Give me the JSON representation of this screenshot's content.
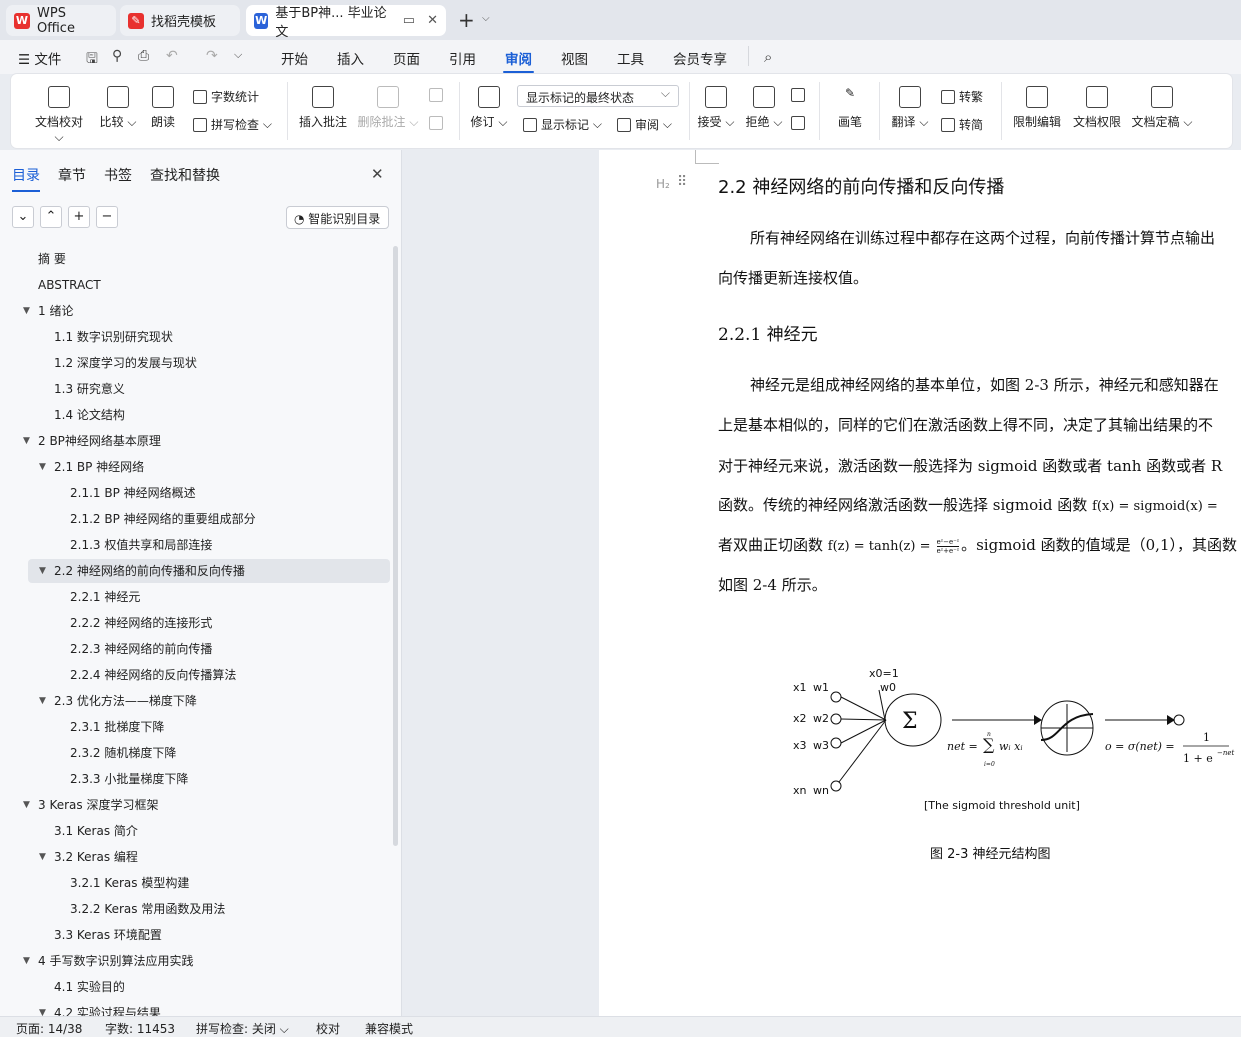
{
  "tabs": [
    {
      "label": "WPS Office",
      "icon": "wps-logo-icon"
    },
    {
      "label": "找稻壳模板",
      "icon": "docer-logo-icon"
    },
    {
      "label": "基于BP神... 毕业论文",
      "icon": "word-doc-icon"
    }
  ],
  "menu": {
    "file": "文件",
    "items": [
      "开始",
      "插入",
      "页面",
      "引用",
      "审阅",
      "视图",
      "工具",
      "会员专享"
    ],
    "active": "审阅"
  },
  "ribbon": {
    "doc_check": "文档校对",
    "compare": "比较",
    "read_aloud": "朗读",
    "word_count": "字数统计",
    "spell_check": "拼写检查",
    "insert_comment": "插入批注",
    "delete_comment": "删除批注",
    "track_changes": "修订",
    "display_state": "显示标记的最终状态",
    "show_markup": "显示标记",
    "review": "审阅",
    "accept": "接受",
    "reject": "拒绝",
    "pen": "画笔",
    "translate": "翻译",
    "to_traditional": "转繁",
    "to_simplified": "转简",
    "restrict_edit": "限制编辑",
    "doc_permission": "文档权限",
    "doc_finalize": "文档定稿"
  },
  "panel": {
    "tabs": [
      "目录",
      "章节",
      "书签",
      "查找和替换"
    ],
    "active_tab": "目录",
    "smart_toc": "智能识别目录",
    "toc": [
      {
        "text": "摘  要",
        "level": 0
      },
      {
        "text": "ABSTRACT",
        "level": 0
      },
      {
        "text": "1  绪论",
        "level": 0,
        "expanded": true
      },
      {
        "text": "1.1  数字识别研究现状",
        "level": 1
      },
      {
        "text": "1.2  深度学习的发展与现状",
        "level": 1
      },
      {
        "text": "1.3  研究意义",
        "level": 1
      },
      {
        "text": "1.4  论文结构",
        "level": 1
      },
      {
        "text": "2 BP神经网络基本原理",
        "level": 0,
        "expanded": true
      },
      {
        "text": "2.1 BP 神经网络",
        "level": 1,
        "expanded": true
      },
      {
        "text": "2.1.1 BP 神经网络概述",
        "level": 2
      },
      {
        "text": "2.1.2 BP 神经网络的重要组成部分",
        "level": 2
      },
      {
        "text": "2.1.3  权值共享和局部连接",
        "level": 2
      },
      {
        "text": "2.2  神经网络的前向传播和反向传播",
        "level": 1,
        "expanded": true,
        "selected": true
      },
      {
        "text": "2.2.1  神经元",
        "level": 2
      },
      {
        "text": "2.2.2  神经网络的连接形式",
        "level": 2
      },
      {
        "text": "2.2.3  神经网络的前向传播",
        "level": 2
      },
      {
        "text": "2.2.4  神经网络的反向传播算法",
        "level": 2
      },
      {
        "text": "2.3  优化方法——梯度下降",
        "level": 1,
        "expanded": true
      },
      {
        "text": "2.3.1  批梯度下降",
        "level": 2
      },
      {
        "text": "2.3.2  随机梯度下降",
        "level": 2
      },
      {
        "text": "2.3.3  小批量梯度下降",
        "level": 2
      },
      {
        "text": "3 Keras 深度学习框架",
        "level": 0,
        "expanded": true
      },
      {
        "text": "3.1 Keras 简介",
        "level": 1
      },
      {
        "text": "3.2 Keras 编程",
        "level": 1,
        "expanded": true
      },
      {
        "text": "3.2.1 Keras 模型构建",
        "level": 2
      },
      {
        "text": "3.2.2 Keras 常用函数及用法",
        "level": 2
      },
      {
        "text": "3.3 Keras 环境配置",
        "level": 1
      },
      {
        "text": "4  手写数字识别算法应用实践",
        "level": 0,
        "expanded": true
      },
      {
        "text": "4.1 实验目的",
        "level": 1
      },
      {
        "text": "4.2 实验过程与结果",
        "level": 1,
        "expanded": true
      }
    ]
  },
  "document": {
    "heading_marker": "H₂",
    "h2": "2.2  神经网络的前向传播和反向传播",
    "p1_line1": "所有神经网络在训练过程中都存在这两个过程，向前传播计算节点输出",
    "p1_line2": "向传播更新连接权值。",
    "h3": "2.2.1  神经元",
    "p2_line1": "神经元是组成神经网络的基本单位，如图 2-3 所示，神经元和感知器在",
    "p2_line2": "上是基本相似的，同样的它们在激活函数上得不同，决定了其输出结果的不",
    "p2_line3": "对于神经元来说，激活函数一般选择为 sigmoid 函数或者 tanh 函数或者 R",
    "p2_line4_a": "函数。传统的神经网络激活函数一般选择 sigmoid 函数 ",
    "p2_line4_eq": "f(x) = sigmoid(x) = ",
    "p2_line5_a": "者双曲正切函数 ",
    "p2_line5_eq": "f(z) = tanh(z) = ",
    "p2_line5_b": "。sigmoid 函数的值域是（0,1），其函数",
    "p2_line6": "如图 2-4 所示。",
    "figure": {
      "x0": "x0=1",
      "w0": "w0",
      "inputs": [
        {
          "x": "x1",
          "w": "w1"
        },
        {
          "x": "x2",
          "w": "w2"
        },
        {
          "x": "x3",
          "w": "w3"
        },
        {
          "x": "xn",
          "w": "wn"
        }
      ],
      "sum_symbol": "Σ",
      "net_eq": "net = ",
      "net_sum_top": "n",
      "net_sum_bottom": "i=0",
      "net_terms": "wᵢ xᵢ",
      "out_eq": "o = σ(net) = ",
      "out_num": "1",
      "out_den": "1 + e",
      "out_exp": "−net",
      "caption_inner": "[The sigmoid threshold unit]",
      "caption": "图 2-3  神经元结构图"
    }
  },
  "status": {
    "page": "页面: 14/38",
    "words": "字数: 11453",
    "spell": "拼写检查: 关闭",
    "proof": "校对",
    "compat": "兼容模式"
  }
}
